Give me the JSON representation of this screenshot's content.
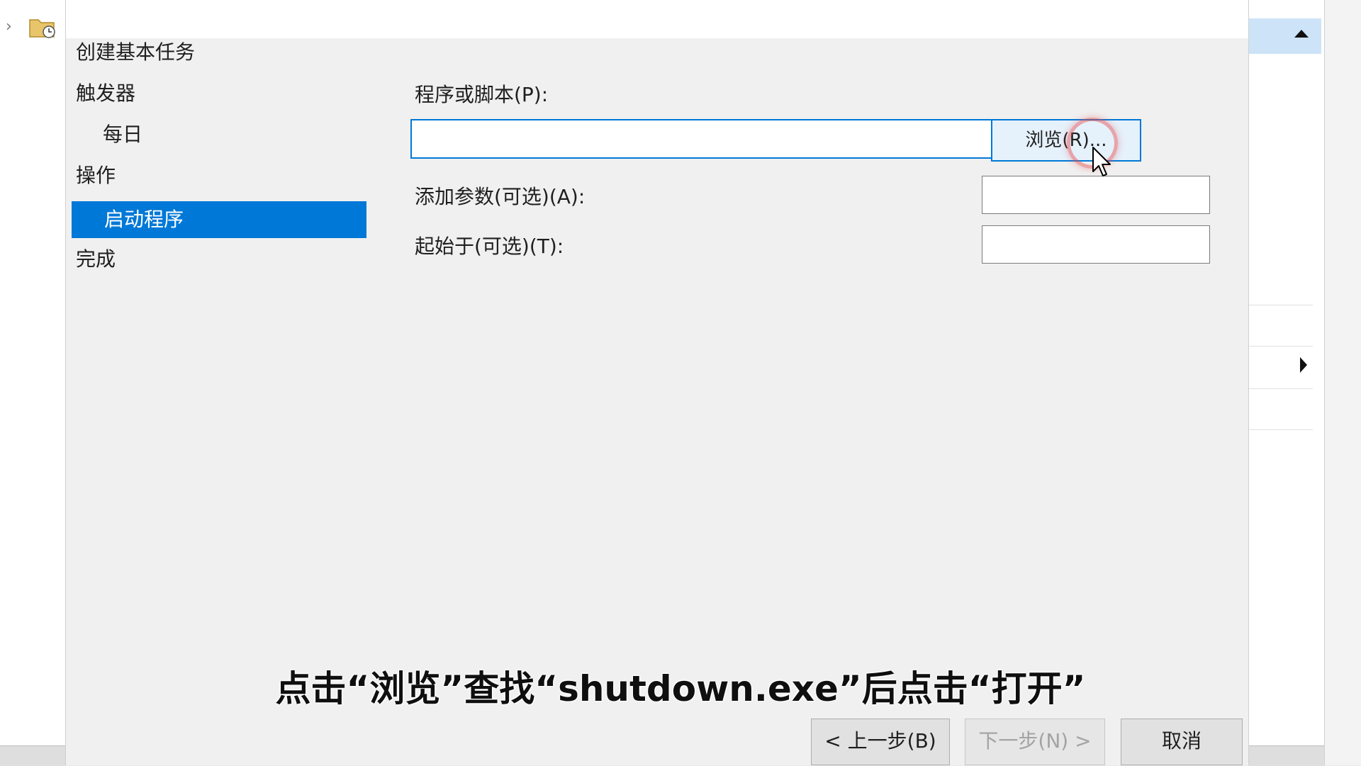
{
  "wizard": {
    "title": "创建基本任务",
    "steps": [
      {
        "label": "触发器"
      },
      {
        "label": "每日"
      },
      {
        "label": "操作"
      },
      {
        "label": "启动程序"
      },
      {
        "label": "完成"
      }
    ],
    "selected_step": "启动程序"
  },
  "form": {
    "program_label": "程序或脚本(P):",
    "program_value": "",
    "browse_label": "浏览(R)...",
    "args_label": "添加参数(可选)(A):",
    "args_value": "",
    "start_in_label": "起始于(可选)(T):",
    "start_in_value": ""
  },
  "footer": {
    "back_label": "< 上一步(B)",
    "next_label": "下一步(N) >",
    "cancel_label": "取消"
  },
  "subtitle": "点击“浏览”查找“shutdown.exe”后点击“打开”",
  "icons": {
    "tree_expand": "chevron-right-icon",
    "tree_folder": "task-folder-icon",
    "pane_collapse": "triangle-up-icon",
    "submenu": "triangle-right-icon",
    "pointer": "mouse-cursor-icon"
  },
  "colors": {
    "selection": "#0078d7",
    "dialog_bg": "#f0f0f0",
    "button_hover_bg": "#e5f1fb"
  }
}
